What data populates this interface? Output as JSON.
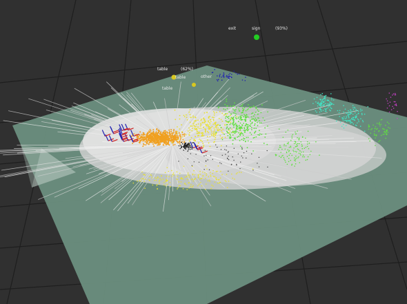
{
  "viewer": {
    "background_color": "#303030",
    "grid_line_color": "#1e1e1e",
    "ground_plane_color": "#6b8f80",
    "map_surface_color": "#d9d9d9"
  },
  "labels": {
    "exit": "exit",
    "sign": "sign",
    "sign_confidence": "(93%)",
    "table_upper": "table",
    "table_upper_confidence": "(62%)",
    "table_lower": "table",
    "table_tag": "table",
    "other_tag": "other"
  },
  "markers": {
    "sign_color": "#22cc22",
    "table_color": "#d8c820"
  },
  "point_cloud_colors": {
    "orange": "#f0a020",
    "yellow": "#e8e030",
    "green": "#60e040",
    "cyan": "#40e8c8",
    "blue": "#2020b0",
    "red": "#d02020",
    "magenta": "#c040c0"
  }
}
